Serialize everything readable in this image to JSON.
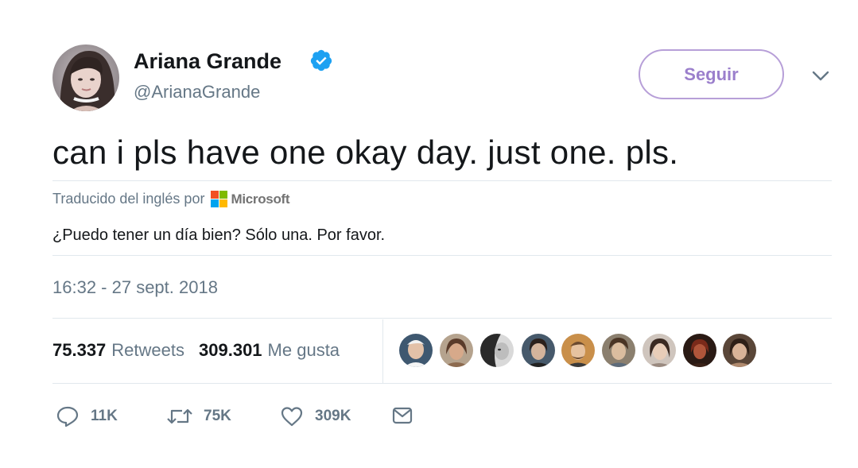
{
  "author": {
    "display_name": "Ariana Grande",
    "handle": "@ArianaGrande",
    "verified_icon": "verified-badge-icon"
  },
  "follow_button": {
    "label": "Seguir"
  },
  "menu": {
    "icon": "chevron-down-icon"
  },
  "tweet": {
    "text": "can i pls have one okay day. just one. pls.",
    "translated_by_label": "Traducido del inglés por",
    "translator_name": "Microsoft",
    "translation": "¿Puedo tener un día bien? Sólo una. Por favor.",
    "timestamp": "16:32 - 27 sept. 2018"
  },
  "stats": {
    "retweets_count": "75.337",
    "retweets_label": "Retweets",
    "likes_count": "309.301",
    "likes_label": "Me gusta"
  },
  "likers_count_shown": 9,
  "actions": {
    "reply": {
      "icon": "reply-icon",
      "count": "11K"
    },
    "retweet": {
      "icon": "retweet-icon",
      "count": "75K"
    },
    "like": {
      "icon": "heart-icon",
      "count": "309K"
    },
    "message": {
      "icon": "envelope-icon"
    }
  },
  "colors": {
    "verified_blue": "#1da1f2",
    "follow_border": "#b79fd8",
    "follow_text": "#9b7fcc",
    "muted_text": "#657786",
    "divider": "#e1e8ed",
    "ms_red": "#f25022",
    "ms_green": "#7fba00",
    "ms_blue": "#00a4ef",
    "ms_yellow": "#ffb900"
  }
}
